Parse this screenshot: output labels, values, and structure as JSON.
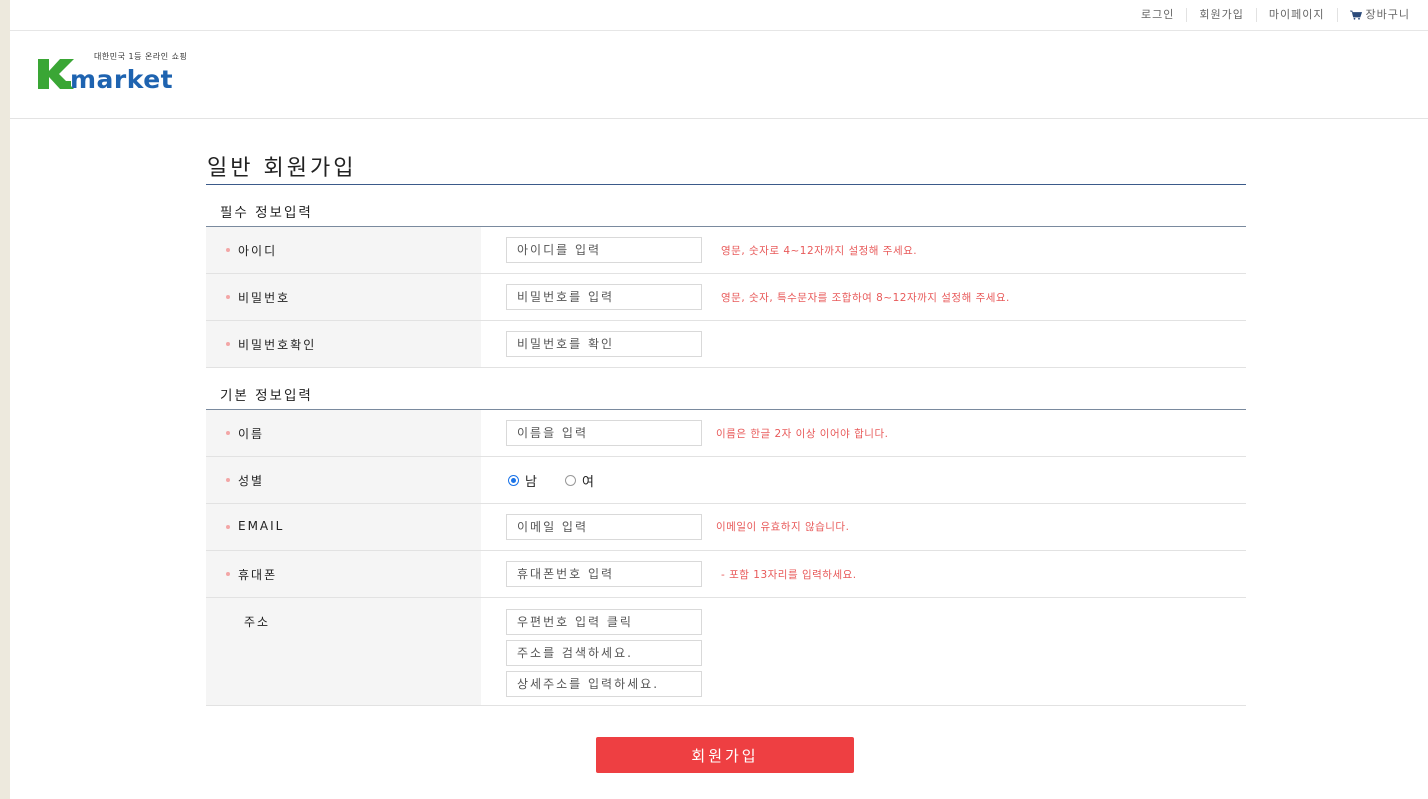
{
  "topnav": {
    "login": "로그인",
    "signup": "회원가입",
    "mypage": "마이페이지",
    "cart": "장바구니"
  },
  "logo": {
    "tagline": "대한민국 1등 온라인 쇼핑",
    "wordmark": "Kmarket",
    "colors": {
      "k": "#3aa635",
      "market": "#1e63b0"
    }
  },
  "page_title": "일반 회원가입",
  "sections": {
    "required": "필수 정보입력",
    "basic": "기본 정보입력"
  },
  "fields": {
    "id": {
      "label": "아이디",
      "placeholder": "아이디를 입력",
      "hint": "영문, 숫자로 4~12자까지 설정해 주세요."
    },
    "password": {
      "label": "비밀번호",
      "placeholder": "비밀번호를 입력",
      "hint": "영문, 숫자, 특수문자를 조합하여 8~12자까지 설정해 주세요."
    },
    "password_confirm": {
      "label": "비밀번호확인",
      "placeholder": "비밀번호를 확인"
    },
    "name": {
      "label": "이름",
      "placeholder": "이름을 입력",
      "hint": "이름은 한글 2자 이상 이어야 합니다."
    },
    "gender": {
      "label": "성별",
      "male": "남",
      "female": "여",
      "selected": "남"
    },
    "email": {
      "label": "EMAIL",
      "placeholder": "이메일 입력",
      "hint": "이메일이 유효하지 않습니다."
    },
    "phone": {
      "label": "휴대폰",
      "placeholder": "휴대폰번호 입력",
      "hint": "- 포함 13자리를 입력하세요."
    },
    "address": {
      "label": "주소",
      "zip_placeholder": "우편번호 입력 클릭",
      "addr_placeholder": "주소를 검색하세요.",
      "detail_placeholder": "상세주소를 입력하세요."
    }
  },
  "submit_label": "회원가입",
  "colors": {
    "accent": "#ee3f42",
    "hint": "#e85a5a",
    "title_line": "#3b5a8a"
  }
}
